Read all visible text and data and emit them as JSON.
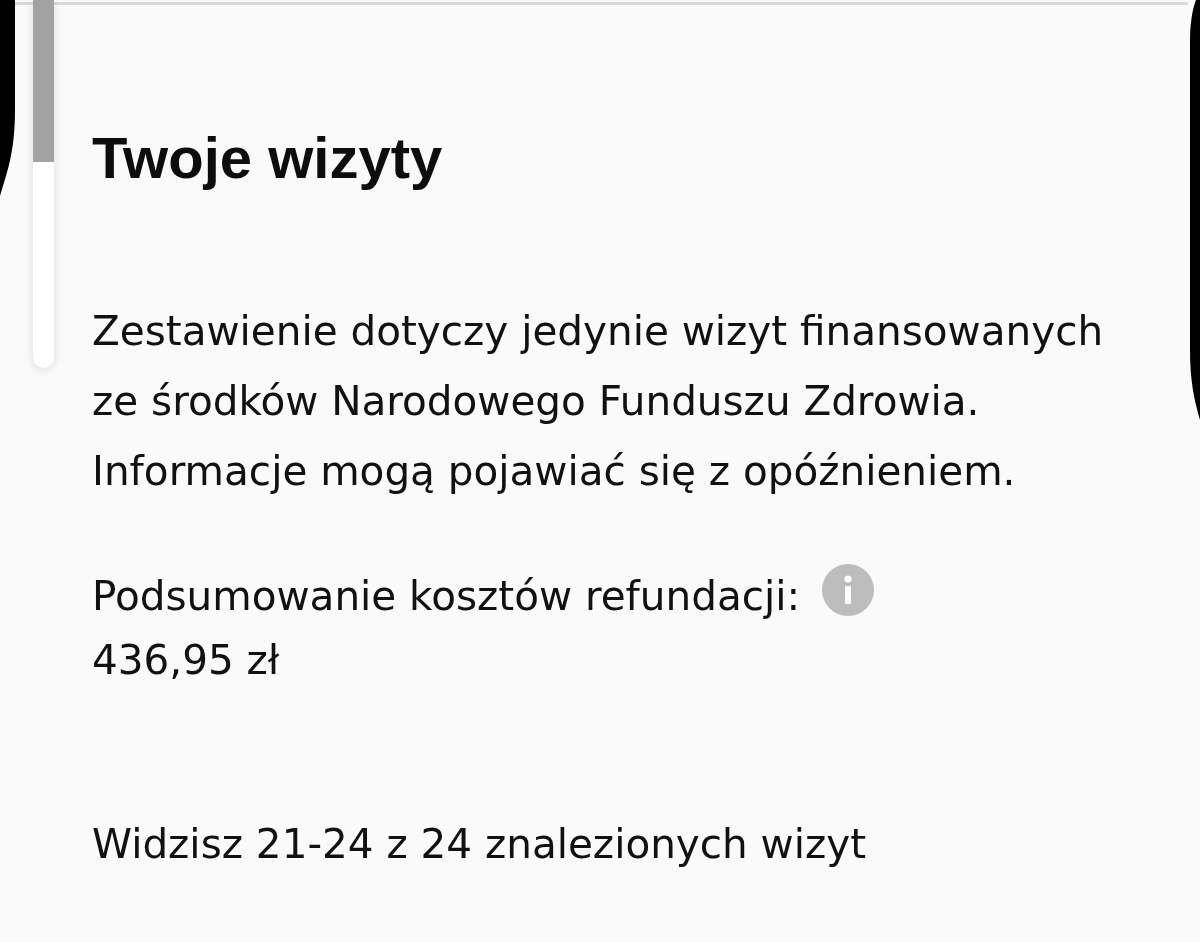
{
  "page": {
    "title": "Twoje wizyty",
    "description": "Zestawienie dotyczy jedynie wizyt finansowanych ze środków Narodowego Funduszu Zdrowia. Informacje mogą pojawiać się z opóźnieniem.",
    "refund_summary": {
      "label": "Podsumowanie kosztów refundacji:",
      "value": "436,95 zł"
    },
    "results_count": "Widzisz 21-24 z 24 znalezionych wizyt"
  }
}
